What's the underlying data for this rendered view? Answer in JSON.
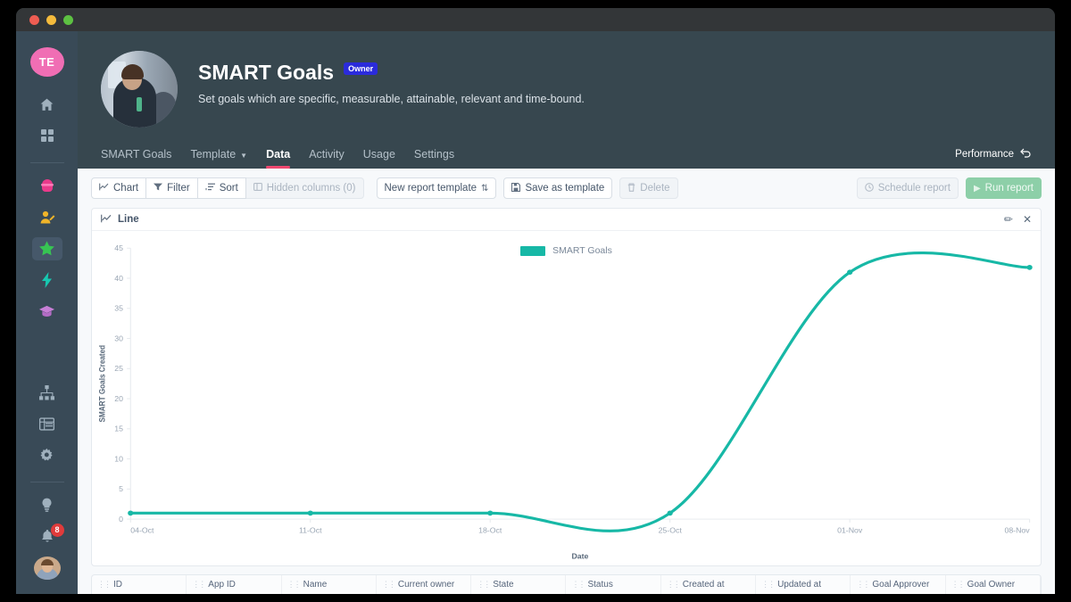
{
  "window": {
    "traffic_lights": [
      "close",
      "minimize",
      "maximize"
    ]
  },
  "sidebar": {
    "account_initials": "TE",
    "items": [
      {
        "name": "home-icon",
        "glyph": "⌂",
        "color": "#9fb0bd",
        "active": false
      },
      {
        "name": "apps-grid-icon",
        "glyph": "▦",
        "color": "#9fb0bd",
        "active": false
      },
      {
        "name": "app-ninja-icon",
        "glyph": "⬤",
        "color": "#ea3a8b",
        "active": false
      },
      {
        "name": "app-user-edit-icon",
        "glyph": "✎",
        "color": "#f0b429",
        "active": false
      },
      {
        "name": "app-star-icon",
        "glyph": "★",
        "color": "#37c453",
        "active": true
      },
      {
        "name": "app-lightning-icon",
        "glyph": "⚡",
        "color": "#17c8b0",
        "active": false
      },
      {
        "name": "app-graduation-icon",
        "glyph": "🎓",
        "color": "#c77fd6",
        "active": false
      },
      {
        "name": "hierarchy-icon",
        "glyph": "⛬",
        "color": "#9fb0bd",
        "active": false
      },
      {
        "name": "table-icon",
        "glyph": "▤",
        "color": "#9fb0bd",
        "active": false
      },
      {
        "name": "settings-gear-icon",
        "glyph": "✿",
        "color": "#9fb0bd",
        "active": false
      },
      {
        "name": "lightbulb-icon",
        "glyph": "💡",
        "color": "#9fb0bd",
        "active": false
      }
    ],
    "notification_count": "8"
  },
  "header": {
    "title": "SMART Goals",
    "badge": "Owner",
    "subtitle": "Set goals which are specific, measurable, attainable, relevant and time-bound.",
    "performance_label": "Performance"
  },
  "tabs": [
    {
      "label": "SMART Goals",
      "active": false,
      "has_chevron": false
    },
    {
      "label": "Template",
      "active": false,
      "has_chevron": true
    },
    {
      "label": "Data",
      "active": true,
      "has_chevron": false
    },
    {
      "label": "Activity",
      "active": false,
      "has_chevron": false
    },
    {
      "label": "Usage",
      "active": false,
      "has_chevron": false
    },
    {
      "label": "Settings",
      "active": false,
      "has_chevron": false
    }
  ],
  "toolbar": {
    "chart_label": "Chart",
    "filter_label": "Filter",
    "sort_label": "Sort",
    "hidden_columns_label": "Hidden columns (0)",
    "report_template_label": "New report template",
    "save_template_label": "Save as template",
    "delete_label": "Delete",
    "schedule_report_label": "Schedule report",
    "run_report_label": "Run report"
  },
  "chart_card": {
    "type_label": "Line",
    "edit_icon": "✏",
    "close_icon": "✕"
  },
  "chart_data": {
    "type": "line",
    "title": "",
    "xlabel": "Date",
    "ylabel": "SMART Goals Created",
    "legend": [
      "SMART Goals"
    ],
    "legend_position": "top-center",
    "series_color": "#17b8a6",
    "grid": false,
    "ylim": [
      0,
      45
    ],
    "yticks": [
      0,
      5,
      10,
      15,
      20,
      25,
      30,
      35,
      40,
      45
    ],
    "xticks": [
      "04-Oct",
      "11-Oct",
      "18-Oct",
      "25-Oct",
      "01-Nov",
      "08-Nov"
    ],
    "x": [
      "04-Oct",
      "11-Oct",
      "18-Oct",
      "25-Oct",
      "01-Nov",
      "08-Nov"
    ],
    "series": [
      {
        "name": "SMART Goals",
        "values": [
          1,
          1,
          1,
          1,
          41,
          41.8
        ]
      }
    ],
    "curve": "smooth",
    "notes": "Flat near 1 from 04-Oct through 25-Oct, then sigmoid rise peaking ~42.3 just after 01-Nov, settling to ~41.8 at 08-Nov"
  },
  "table": {
    "columns": [
      "ID",
      "App ID",
      "Name",
      "Current owner",
      "State",
      "Status",
      "Created at",
      "Updated at",
      "Goal Approver",
      "Goal Owner"
    ]
  }
}
